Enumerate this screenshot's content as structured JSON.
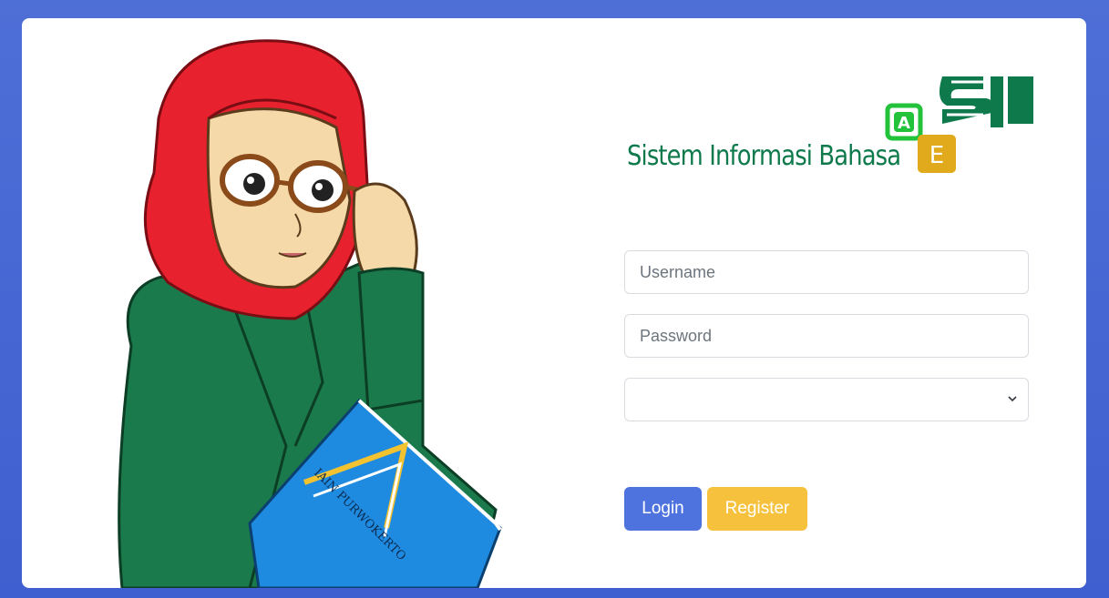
{
  "logo": {
    "mark": "SIB",
    "tagline": "Sistem Informasi Bahasa",
    "badge_letters": [
      "A",
      "E"
    ],
    "colors": {
      "green": "#0e7a4c",
      "bright_green": "#22c33a",
      "gold": "#e0aa1c"
    }
  },
  "illustration": {
    "book_text": "IAIN PURWOKERTO",
    "colors": {
      "hijab": "#e8212e",
      "jacket": "#1b7a4b",
      "book": "#1f8be0",
      "skin": "#f5d9a8"
    }
  },
  "form": {
    "username_placeholder": "Username",
    "password_placeholder": "Password",
    "select_value": ""
  },
  "buttons": {
    "login_label": "Login",
    "register_label": "Register"
  },
  "colors": {
    "background": "#4e6fd6",
    "login": "#4e73df",
    "register": "#f6c23e"
  }
}
